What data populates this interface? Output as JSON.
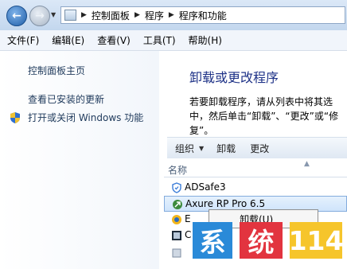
{
  "window": {
    "breadcrumb": [
      "控制面板",
      "程序",
      "程序和功能"
    ]
  },
  "menubar": {
    "items": [
      "文件(F)",
      "编辑(E)",
      "查看(V)",
      "工具(T)",
      "帮助(H)"
    ]
  },
  "taskpane": {
    "home_link": "控制面板主页",
    "updates_link": "查看已安装的更新",
    "features_link": "打开或关闭 Windows 功能"
  },
  "main": {
    "heading": "卸载或更改程序",
    "description": "若要卸载程序，请从列表中将其选中，然后单击“卸载”、“更改”或“修复”。",
    "toolbar": {
      "organize": "组织",
      "uninstall": "卸载",
      "change": "更改"
    },
    "column_header": "名称",
    "programs": [
      "ADSafe3",
      "Axure RP Pro 6.5",
      "E",
      "C",
      ""
    ],
    "context_menu_item": "卸载(U)"
  },
  "watermark": [
    "系",
    "统",
    "114"
  ],
  "colors": {
    "heading": "#1e3287",
    "link": "#1e395b",
    "watermark_blue": "#2a8ad8",
    "watermark_red": "#e2343f",
    "watermark_yellow": "#f6c52b"
  }
}
